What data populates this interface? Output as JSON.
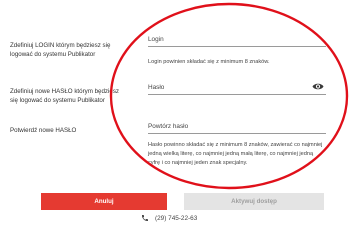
{
  "form": {
    "login_label": "Zdefiniuj LOGIN którym będziesz się logować do systemu Publikator",
    "password_label": "Zdefiniuj nowe HASŁO którym będziesz się logować do systemu Publikator",
    "confirm_label": "Potwierdź nowe HASŁO",
    "login_placeholder": "Login",
    "login_hint": "Login powinien składać się z minimum 8 znaków.",
    "password_placeholder": "Hasło",
    "confirm_placeholder": "Powtórz hasło",
    "password_hint": "Hasło powinno składać się z minimum 8 znaków, zawierać co najmniej jedną wielką literę, co najmniej jedną małą literę, co najmniej jedną cyfrę i co najmniej jeden znak specjalny."
  },
  "buttons": {
    "cancel": "Anuluj",
    "activate": "Aktywuj dostęp"
  },
  "contact": {
    "phone": "(29) 745-22-63"
  },
  "icons": {
    "show_password": "eye-icon",
    "phone": "phone-icon"
  },
  "colors": {
    "accent": "#e53a31",
    "annotation": "#e0101a",
    "disabled_bg": "#e4e4e4"
  }
}
